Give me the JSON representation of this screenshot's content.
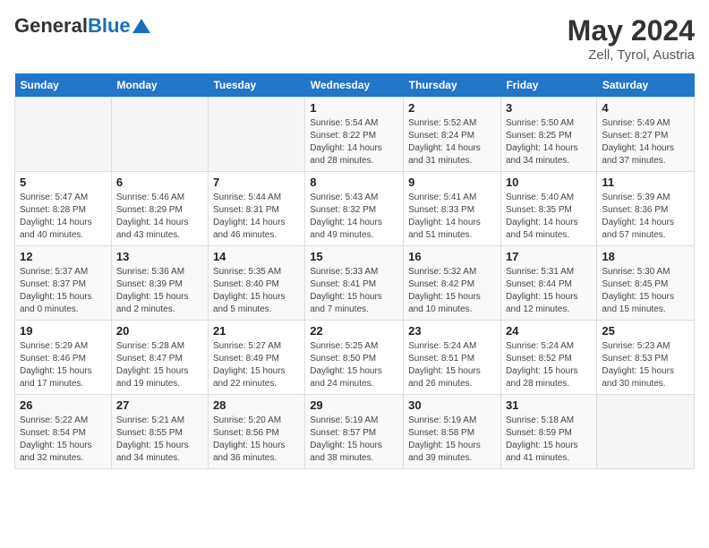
{
  "header": {
    "logo_general": "General",
    "logo_blue": "Blue",
    "title": "May 2024",
    "subtitle": "Zell, Tyrol, Austria"
  },
  "days_of_week": [
    "Sunday",
    "Monday",
    "Tuesday",
    "Wednesday",
    "Thursday",
    "Friday",
    "Saturday"
  ],
  "weeks": [
    [
      {
        "day": "",
        "info": ""
      },
      {
        "day": "",
        "info": ""
      },
      {
        "day": "",
        "info": ""
      },
      {
        "day": "1",
        "info": "Sunrise: 5:54 AM\nSunset: 8:22 PM\nDaylight: 14 hours and 28 minutes."
      },
      {
        "day": "2",
        "info": "Sunrise: 5:52 AM\nSunset: 8:24 PM\nDaylight: 14 hours and 31 minutes."
      },
      {
        "day": "3",
        "info": "Sunrise: 5:50 AM\nSunset: 8:25 PM\nDaylight: 14 hours and 34 minutes."
      },
      {
        "day": "4",
        "info": "Sunrise: 5:49 AM\nSunset: 8:27 PM\nDaylight: 14 hours and 37 minutes."
      }
    ],
    [
      {
        "day": "5",
        "info": "Sunrise: 5:47 AM\nSunset: 8:28 PM\nDaylight: 14 hours and 40 minutes."
      },
      {
        "day": "6",
        "info": "Sunrise: 5:46 AM\nSunset: 8:29 PM\nDaylight: 14 hours and 43 minutes."
      },
      {
        "day": "7",
        "info": "Sunrise: 5:44 AM\nSunset: 8:31 PM\nDaylight: 14 hours and 46 minutes."
      },
      {
        "day": "8",
        "info": "Sunrise: 5:43 AM\nSunset: 8:32 PM\nDaylight: 14 hours and 49 minutes."
      },
      {
        "day": "9",
        "info": "Sunrise: 5:41 AM\nSunset: 8:33 PM\nDaylight: 14 hours and 51 minutes."
      },
      {
        "day": "10",
        "info": "Sunrise: 5:40 AM\nSunset: 8:35 PM\nDaylight: 14 hours and 54 minutes."
      },
      {
        "day": "11",
        "info": "Sunrise: 5:39 AM\nSunset: 8:36 PM\nDaylight: 14 hours and 57 minutes."
      }
    ],
    [
      {
        "day": "12",
        "info": "Sunrise: 5:37 AM\nSunset: 8:37 PM\nDaylight: 15 hours and 0 minutes."
      },
      {
        "day": "13",
        "info": "Sunrise: 5:36 AM\nSunset: 8:39 PM\nDaylight: 15 hours and 2 minutes."
      },
      {
        "day": "14",
        "info": "Sunrise: 5:35 AM\nSunset: 8:40 PM\nDaylight: 15 hours and 5 minutes."
      },
      {
        "day": "15",
        "info": "Sunrise: 5:33 AM\nSunset: 8:41 PM\nDaylight: 15 hours and 7 minutes."
      },
      {
        "day": "16",
        "info": "Sunrise: 5:32 AM\nSunset: 8:42 PM\nDaylight: 15 hours and 10 minutes."
      },
      {
        "day": "17",
        "info": "Sunrise: 5:31 AM\nSunset: 8:44 PM\nDaylight: 15 hours and 12 minutes."
      },
      {
        "day": "18",
        "info": "Sunrise: 5:30 AM\nSunset: 8:45 PM\nDaylight: 15 hours and 15 minutes."
      }
    ],
    [
      {
        "day": "19",
        "info": "Sunrise: 5:29 AM\nSunset: 8:46 PM\nDaylight: 15 hours and 17 minutes."
      },
      {
        "day": "20",
        "info": "Sunrise: 5:28 AM\nSunset: 8:47 PM\nDaylight: 15 hours and 19 minutes."
      },
      {
        "day": "21",
        "info": "Sunrise: 5:27 AM\nSunset: 8:49 PM\nDaylight: 15 hours and 22 minutes."
      },
      {
        "day": "22",
        "info": "Sunrise: 5:25 AM\nSunset: 8:50 PM\nDaylight: 15 hours and 24 minutes."
      },
      {
        "day": "23",
        "info": "Sunrise: 5:24 AM\nSunset: 8:51 PM\nDaylight: 15 hours and 26 minutes."
      },
      {
        "day": "24",
        "info": "Sunrise: 5:24 AM\nSunset: 8:52 PM\nDaylight: 15 hours and 28 minutes."
      },
      {
        "day": "25",
        "info": "Sunrise: 5:23 AM\nSunset: 8:53 PM\nDaylight: 15 hours and 30 minutes."
      }
    ],
    [
      {
        "day": "26",
        "info": "Sunrise: 5:22 AM\nSunset: 8:54 PM\nDaylight: 15 hours and 32 minutes."
      },
      {
        "day": "27",
        "info": "Sunrise: 5:21 AM\nSunset: 8:55 PM\nDaylight: 15 hours and 34 minutes."
      },
      {
        "day": "28",
        "info": "Sunrise: 5:20 AM\nSunset: 8:56 PM\nDaylight: 15 hours and 36 minutes."
      },
      {
        "day": "29",
        "info": "Sunrise: 5:19 AM\nSunset: 8:57 PM\nDaylight: 15 hours and 38 minutes."
      },
      {
        "day": "30",
        "info": "Sunrise: 5:19 AM\nSunset: 8:58 PM\nDaylight: 15 hours and 39 minutes."
      },
      {
        "day": "31",
        "info": "Sunrise: 5:18 AM\nSunset: 8:59 PM\nDaylight: 15 hours and 41 minutes."
      },
      {
        "day": "",
        "info": ""
      }
    ]
  ]
}
